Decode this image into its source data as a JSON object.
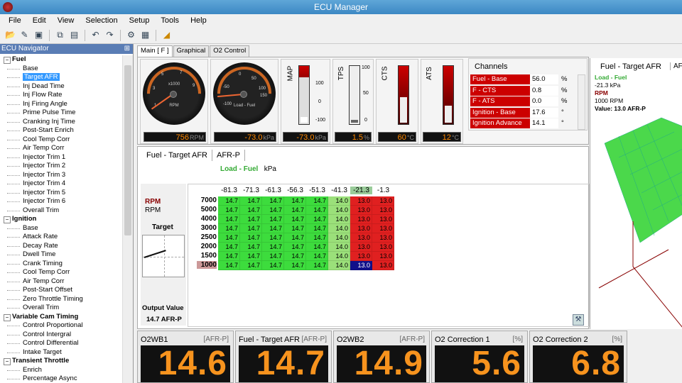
{
  "window": {
    "title": "ECU Manager"
  },
  "menu": [
    "File",
    "Edit",
    "View",
    "Selection",
    "Setup",
    "Tools",
    "Help"
  ],
  "navigator": {
    "title": "ECU Navigator",
    "items": [
      {
        "label": "Fuel",
        "type": "group"
      },
      {
        "label": "Base",
        "type": "sub"
      },
      {
        "label": "Target AFR",
        "type": "sub",
        "selected": true
      },
      {
        "label": "Inj Dead Time",
        "type": "sub"
      },
      {
        "label": "Inj Flow Rate",
        "type": "sub"
      },
      {
        "label": "Inj Firing Angle",
        "type": "sub"
      },
      {
        "label": "Prime Pulse Time",
        "type": "sub"
      },
      {
        "label": "Cranking Inj Time",
        "type": "sub"
      },
      {
        "label": "Post-Start Enrich",
        "type": "sub"
      },
      {
        "label": "Cool Temp Corr",
        "type": "sub"
      },
      {
        "label": "Air Temp Corr",
        "type": "sub"
      },
      {
        "label": "Injector Trim 1",
        "type": "sub"
      },
      {
        "label": "Injector Trim 2",
        "type": "sub"
      },
      {
        "label": "Injector Trim 3",
        "type": "sub"
      },
      {
        "label": "Injector Trim 4",
        "type": "sub"
      },
      {
        "label": "Injector Trim 5",
        "type": "sub"
      },
      {
        "label": "Injector Trim 6",
        "type": "sub"
      },
      {
        "label": "Overall Trim",
        "type": "sub"
      },
      {
        "label": "Ignition",
        "type": "group"
      },
      {
        "label": "Base",
        "type": "sub"
      },
      {
        "label": "Attack Rate",
        "type": "sub"
      },
      {
        "label": "Decay Rate",
        "type": "sub"
      },
      {
        "label": "Dwell Time",
        "type": "sub"
      },
      {
        "label": "Crank Timing",
        "type": "sub"
      },
      {
        "label": "Cool Temp Corr",
        "type": "sub"
      },
      {
        "label": "Air Temp Corr",
        "type": "sub"
      },
      {
        "label": "Post-Start Offset",
        "type": "sub"
      },
      {
        "label": "Zero Throttle Timing",
        "type": "sub"
      },
      {
        "label": "Overall Trim",
        "type": "sub"
      },
      {
        "label": "Variable Cam Timing",
        "type": "group"
      },
      {
        "label": "Control Proportional",
        "type": "sub"
      },
      {
        "label": "Control Intergral",
        "type": "sub"
      },
      {
        "label": "Control Differential",
        "type": "sub"
      },
      {
        "label": "Intake Target",
        "type": "sub"
      },
      {
        "label": "Transient Throttle",
        "type": "group"
      },
      {
        "label": "Enrich",
        "type": "sub"
      },
      {
        "label": "Percentage Async",
        "type": "sub"
      }
    ]
  },
  "tabs": [
    "Main [ F ]",
    "Graphical",
    "O2 Control"
  ],
  "gauges": {
    "rpm": {
      "value": "756",
      "unit": "RPM",
      "sub": "x1000",
      "dial_label": "RPM",
      "ticks": [
        "1",
        "3",
        "5",
        "7",
        "9"
      ]
    },
    "load": {
      "value": "-73.0",
      "unit": "kPa",
      "dial_label": "Load - Fuel",
      "ticks": [
        "-50",
        "0",
        "50",
        "100",
        "150",
        "-100"
      ]
    },
    "map": {
      "label": "MAP",
      "value": "-73.0",
      "unit": "kPa",
      "scale": [
        "100",
        "0",
        "-100"
      ],
      "fill": 0.1
    },
    "tps": {
      "label": "TPS",
      "value": "1.5",
      "unit": "%",
      "scale": [
        "100",
        "50",
        "0"
      ],
      "fill": 0.05
    },
    "cts": {
      "label": "CTS",
      "value": "60",
      "unit": "°C",
      "fill": 0.45
    },
    "ats": {
      "label": "ATS",
      "value": "12",
      "unit": "°C",
      "fill": 0.3
    }
  },
  "channels": {
    "title": "Channels",
    "rows": [
      {
        "name": "Fuel - Base",
        "value": "56.0",
        "unit": "%"
      },
      {
        "name": "F - CTS",
        "value": "0.8",
        "unit": "%"
      },
      {
        "name": "F - ATS",
        "value": "0.0",
        "unit": "%"
      },
      {
        "name": "Ignition - Base",
        "value": "17.6",
        "unit": "°"
      },
      {
        "name": "Ignition Advance",
        "value": "14.1",
        "unit": "°"
      }
    ]
  },
  "table": {
    "tabs": [
      "Fuel - Target AFR",
      "AFR-P"
    ],
    "x_axis_label": "Load - Fuel",
    "x_unit": "kPa",
    "y_axis_label": "RPM",
    "y_axis_label2": "RPM",
    "target_label": "Target",
    "output_label": "Output Value",
    "output_value": "14.7 AFR-P",
    "columns": [
      "-81.3",
      "-71.3",
      "-61.3",
      "-56.3",
      "-51.3",
      "-41.3",
      "-21.3",
      "-1.3"
    ],
    "rows": [
      {
        "rpm": "7000",
        "values": [
          "14.7",
          "14.7",
          "14.7",
          "14.7",
          "14.7",
          "14.0",
          "13.0",
          "13.0"
        ]
      },
      {
        "rpm": "5000",
        "values": [
          "14.7",
          "14.7",
          "14.7",
          "14.7",
          "14.7",
          "14.0",
          "13.0",
          "13.0"
        ]
      },
      {
        "rpm": "4000",
        "values": [
          "14.7",
          "14.7",
          "14.7",
          "14.7",
          "14.7",
          "14.0",
          "13.0",
          "13.0"
        ]
      },
      {
        "rpm": "3000",
        "values": [
          "14.7",
          "14.7",
          "14.7",
          "14.7",
          "14.7",
          "14.0",
          "13.0",
          "13.0"
        ]
      },
      {
        "rpm": "2500",
        "values": [
          "14.7",
          "14.7",
          "14.7",
          "14.7",
          "14.7",
          "14.0",
          "13.0",
          "13.0"
        ]
      },
      {
        "rpm": "2000",
        "values": [
          "14.7",
          "14.7",
          "14.7",
          "14.7",
          "14.7",
          "14.0",
          "13.0",
          "13.0"
        ]
      },
      {
        "rpm": "1500",
        "values": [
          "14.7",
          "14.7",
          "14.7",
          "14.7",
          "14.7",
          "14.0",
          "13.0",
          "13.0"
        ]
      },
      {
        "rpm": "1000",
        "values": [
          "14.7",
          "14.7",
          "14.7",
          "14.7",
          "14.7",
          "14.0",
          "13.0",
          "13.0"
        ]
      }
    ],
    "highlight_col": 6,
    "highlight_row": 7,
    "selected_cell": [
      7,
      6
    ]
  },
  "view3d": {
    "title": "Fuel - Target AFR",
    "tab": "AFR",
    "load_label": "Load - Fuel",
    "load_value": "-21.3 kPa",
    "rpm_label": "RPM",
    "rpm_value": "1000 RPM",
    "value_text": "Value: 13.0 AFR-P"
  },
  "bottom_gauges": [
    {
      "title": "O2WB1",
      "unit": "[AFR-P]",
      "value": "14.6"
    },
    {
      "title": "Fuel - Target AFR",
      "unit": "[AFR-P]",
      "value": "14.7"
    },
    {
      "title": "O2WB2",
      "unit": "[AFR-P]",
      "value": "14.9"
    },
    {
      "title": "O2 Correction 1",
      "unit": "[%]",
      "value": "5.6"
    },
    {
      "title": "O2 Correction 2",
      "unit": "[%]",
      "value": "6.8"
    }
  ],
  "colors": {
    "green": "#3ddc3d",
    "lightgreen": "#9be07a",
    "red": "#e02020",
    "selected": "#10108a",
    "title_blue": "#3c88c4"
  }
}
